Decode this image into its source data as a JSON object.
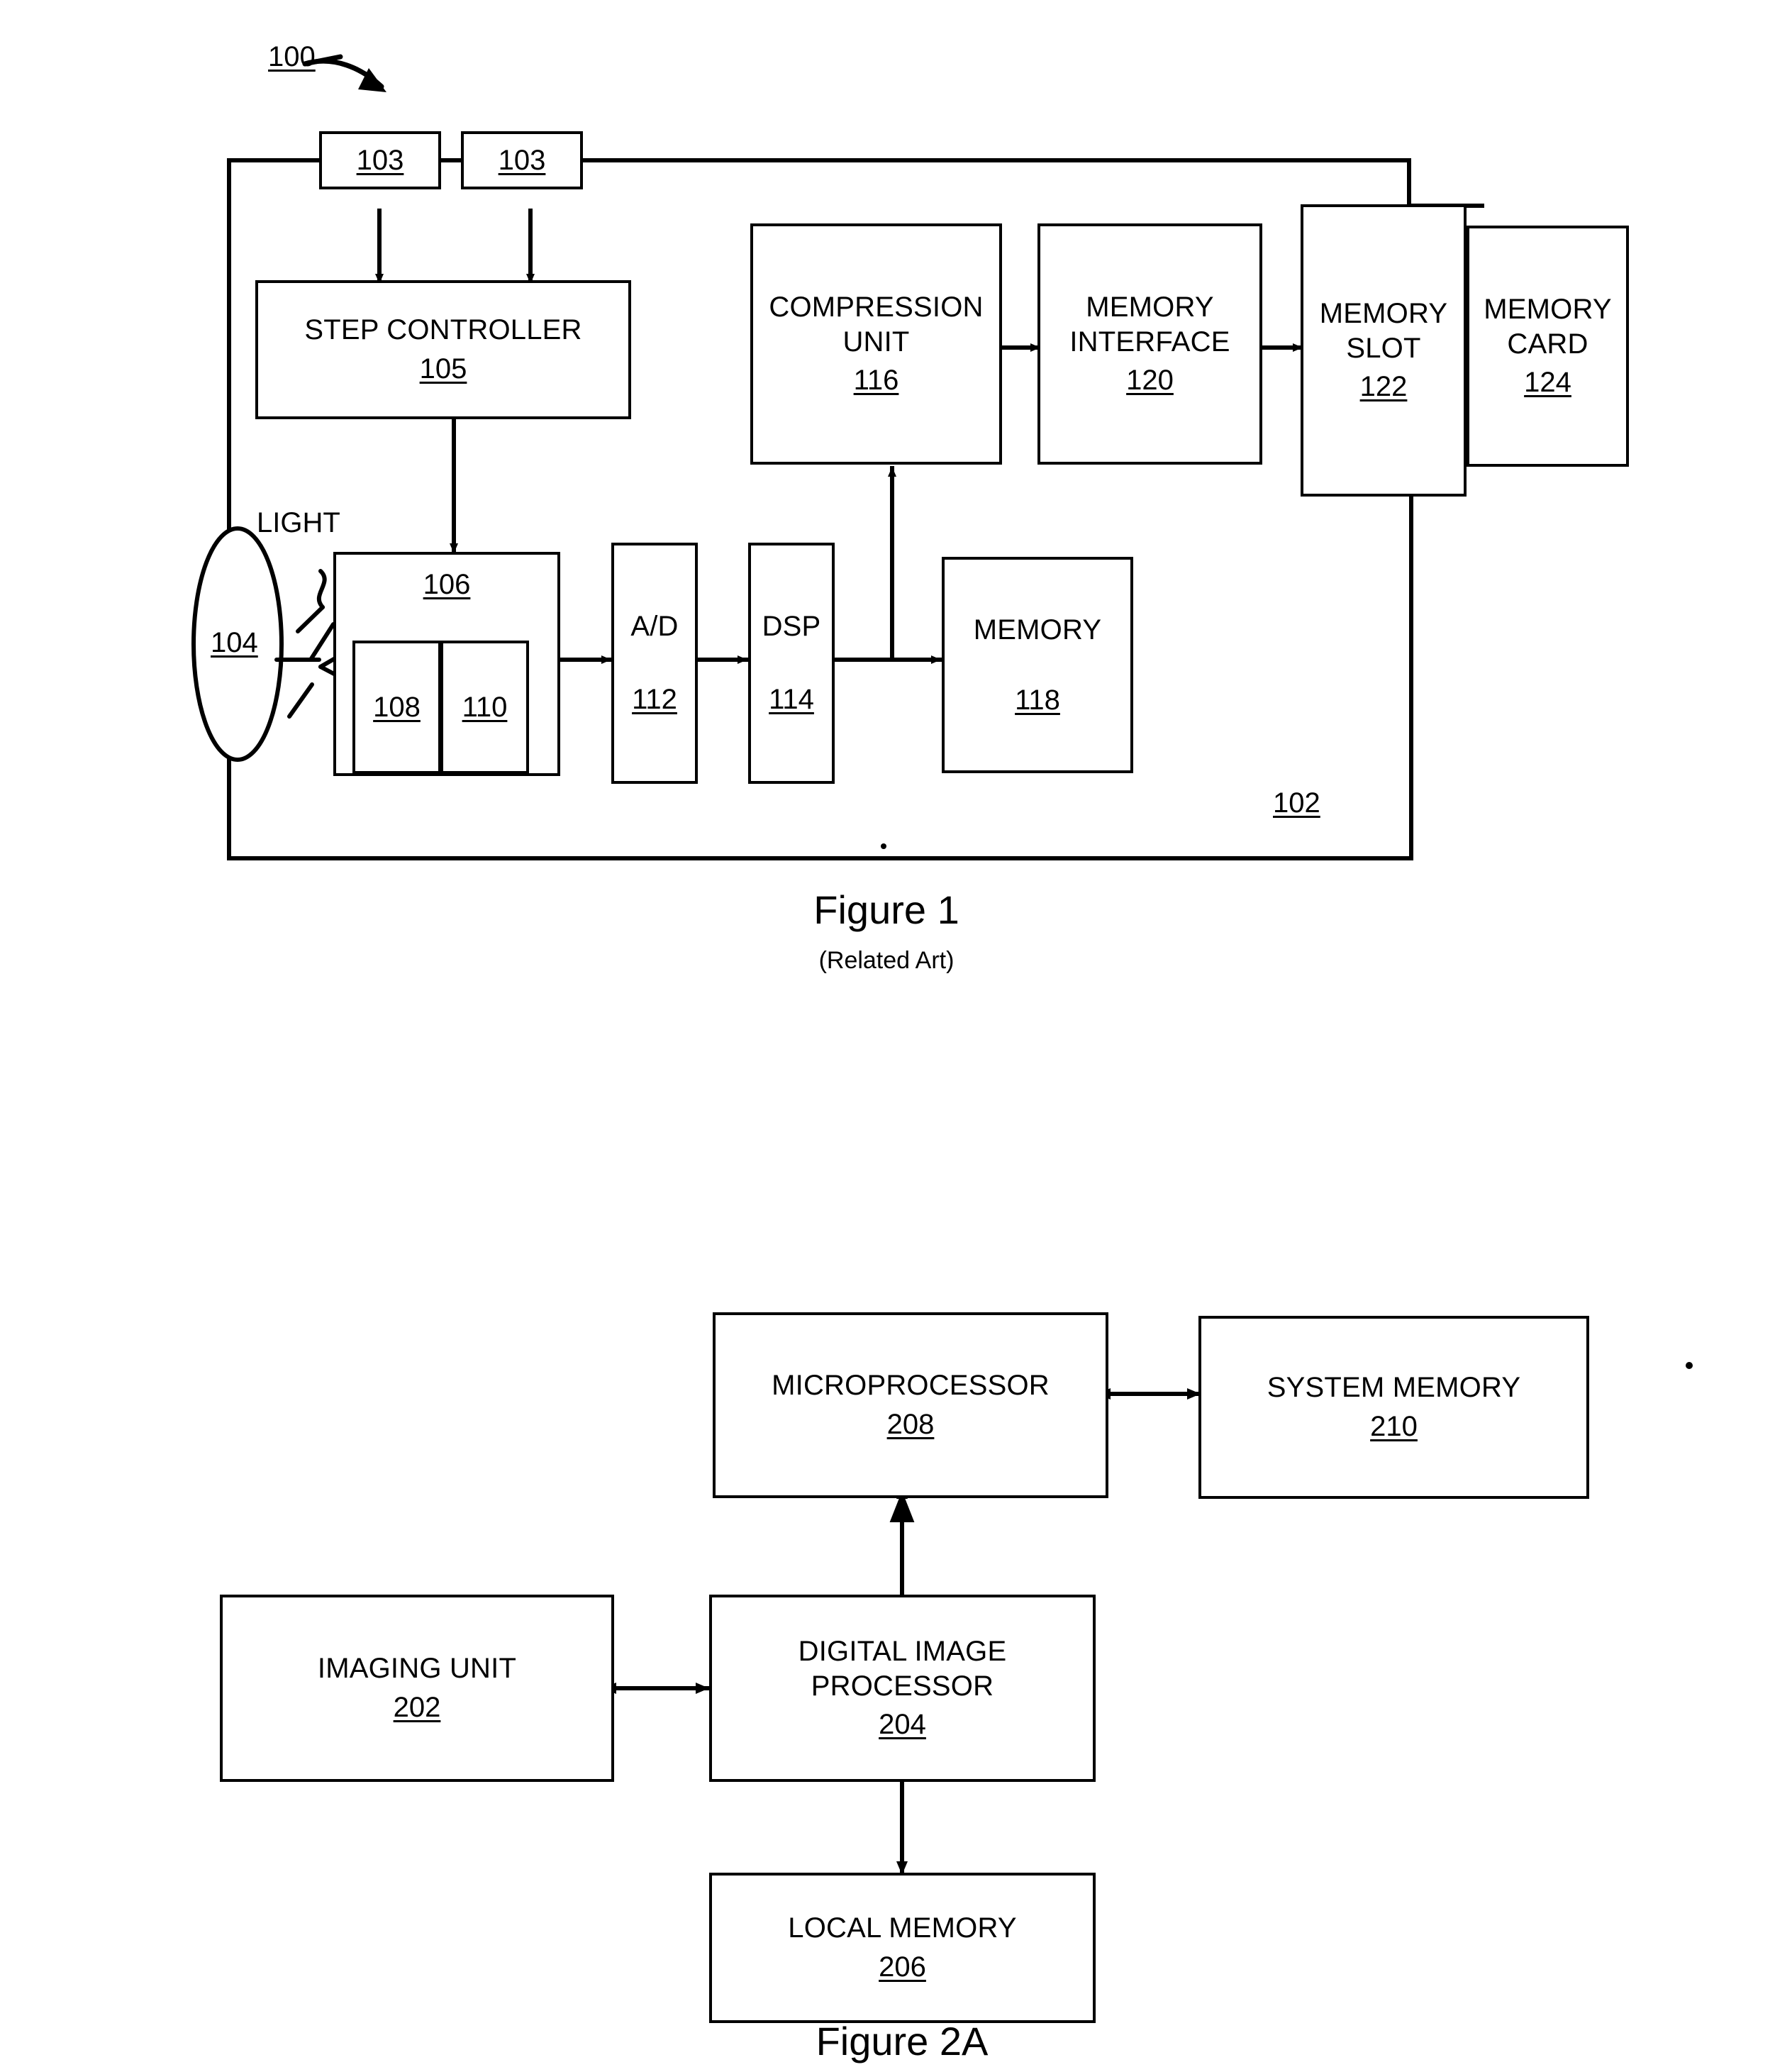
{
  "page": {
    "type": "patent-drawing-sheet",
    "background": "#ffffff",
    "ink": "#000000"
  },
  "figure1": {
    "system_ref": "100",
    "device_ref": "102",
    "caption": "Figure 1",
    "subcaption": "(Related Art)",
    "blocks": [
      {
        "key": "b103a",
        "label": "",
        "num": "103"
      },
      {
        "key": "b103b",
        "label": "",
        "num": "103"
      },
      {
        "key": "step_controller",
        "label": "STEP CONTROLLER",
        "num": "105"
      },
      {
        "key": "compression_unit",
        "label": "COMPRESSION\nUNIT",
        "num": "116"
      },
      {
        "key": "memory_interface",
        "label": "MEMORY\nINTERFACE",
        "num": "120"
      },
      {
        "key": "memory_slot",
        "label": "MEMORY\nSLOT",
        "num": "122"
      },
      {
        "key": "memory_card",
        "label": "MEMORY\nCARD",
        "num": "124"
      },
      {
        "key": "sensor",
        "label": "",
        "num": "106"
      },
      {
        "key": "sensor_sub_a",
        "label": "",
        "num": "108"
      },
      {
        "key": "sensor_sub_b",
        "label": "",
        "num": "110"
      },
      {
        "key": "ad",
        "label": "A/D",
        "num": "112"
      },
      {
        "key": "dsp",
        "label": "DSP",
        "num": "114"
      },
      {
        "key": "memory",
        "label": "MEMORY",
        "num": "118"
      }
    ],
    "lens": {
      "num": "104",
      "light_label": "LIGHT"
    }
  },
  "figure2a": {
    "caption": "Figure 2A",
    "blocks": [
      {
        "key": "microprocessor",
        "label": "MICROPROCESSOR",
        "num": "208"
      },
      {
        "key": "system_memory",
        "label": "SYSTEM MEMORY",
        "num": "210"
      },
      {
        "key": "imaging_unit",
        "label": "IMAGING UNIT",
        "num": "202"
      },
      {
        "key": "digital_image_processor",
        "label": "DIGITAL IMAGE\nPROCESSOR",
        "num": "204"
      },
      {
        "key": "local_memory",
        "label": "LOCAL MEMORY",
        "num": "206"
      }
    ]
  }
}
